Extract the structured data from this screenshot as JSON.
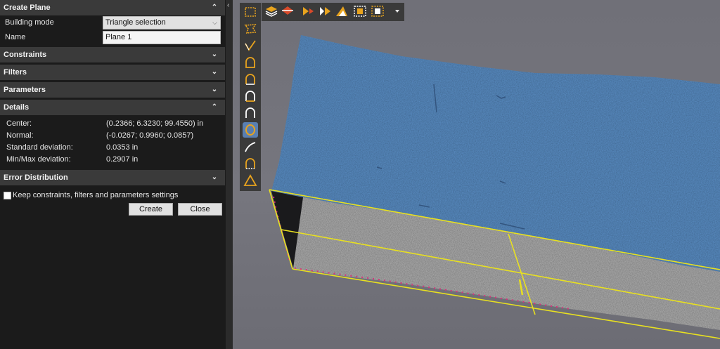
{
  "panel": {
    "title": "Create Plane",
    "building_mode": {
      "label": "Building mode",
      "value": "Triangle selection"
    },
    "name": {
      "label": "Name",
      "value": "Plane 1"
    },
    "sections": {
      "constraints": "Constraints",
      "filters": "Filters",
      "parameters": "Parameters",
      "details": "Details",
      "error_distribution": "Error Distribution"
    },
    "details": {
      "center_label": "Center:",
      "center_value": "(0.2366; 6.3230; 99.4550) in",
      "normal_label": "Normal:",
      "normal_value": "(-0.0267; 0.9960; 0.0857)",
      "std_label": "Standard deviation:",
      "std_value": "0.0353 in",
      "minmax_label": "Min/Max deviation:",
      "minmax_value": "0.2907 in"
    },
    "keep_settings": {
      "label": "Keep constraints, filters and parameters settings",
      "checked": false
    },
    "buttons": {
      "create": "Create",
      "close": "Close"
    }
  },
  "toolbar": {
    "vertical_icons": [
      "rectangle-select-icon",
      "lasso-select-icon",
      "polyline-select-icon",
      "arch-tool-icon",
      "arch-tool-2-icon",
      "arch-tool-3-icon",
      "arch-outline-icon",
      "circle-select-icon",
      "arc-line-icon",
      "arch-dashed-icon",
      "triangle-icon"
    ],
    "selected_vertical": "circle-select-icon",
    "horizontal_icons": [
      "layers-icon",
      "mirror-icon",
      "grow-selection-icon",
      "shrink-selection-icon",
      "invert-selection-icon",
      "select-all-icon",
      "deselect-icon",
      "dropdown-icon"
    ]
  },
  "colors": {
    "panel_bg": "#1b1b1b",
    "section_header": "#3a3a3a",
    "scan_top": "#5b8fc6",
    "scan_side": "#6e6e6e",
    "plane_outline": "#e8e020",
    "toolbar_icon": "#e8a31e",
    "viewport_bg": "#727279"
  }
}
